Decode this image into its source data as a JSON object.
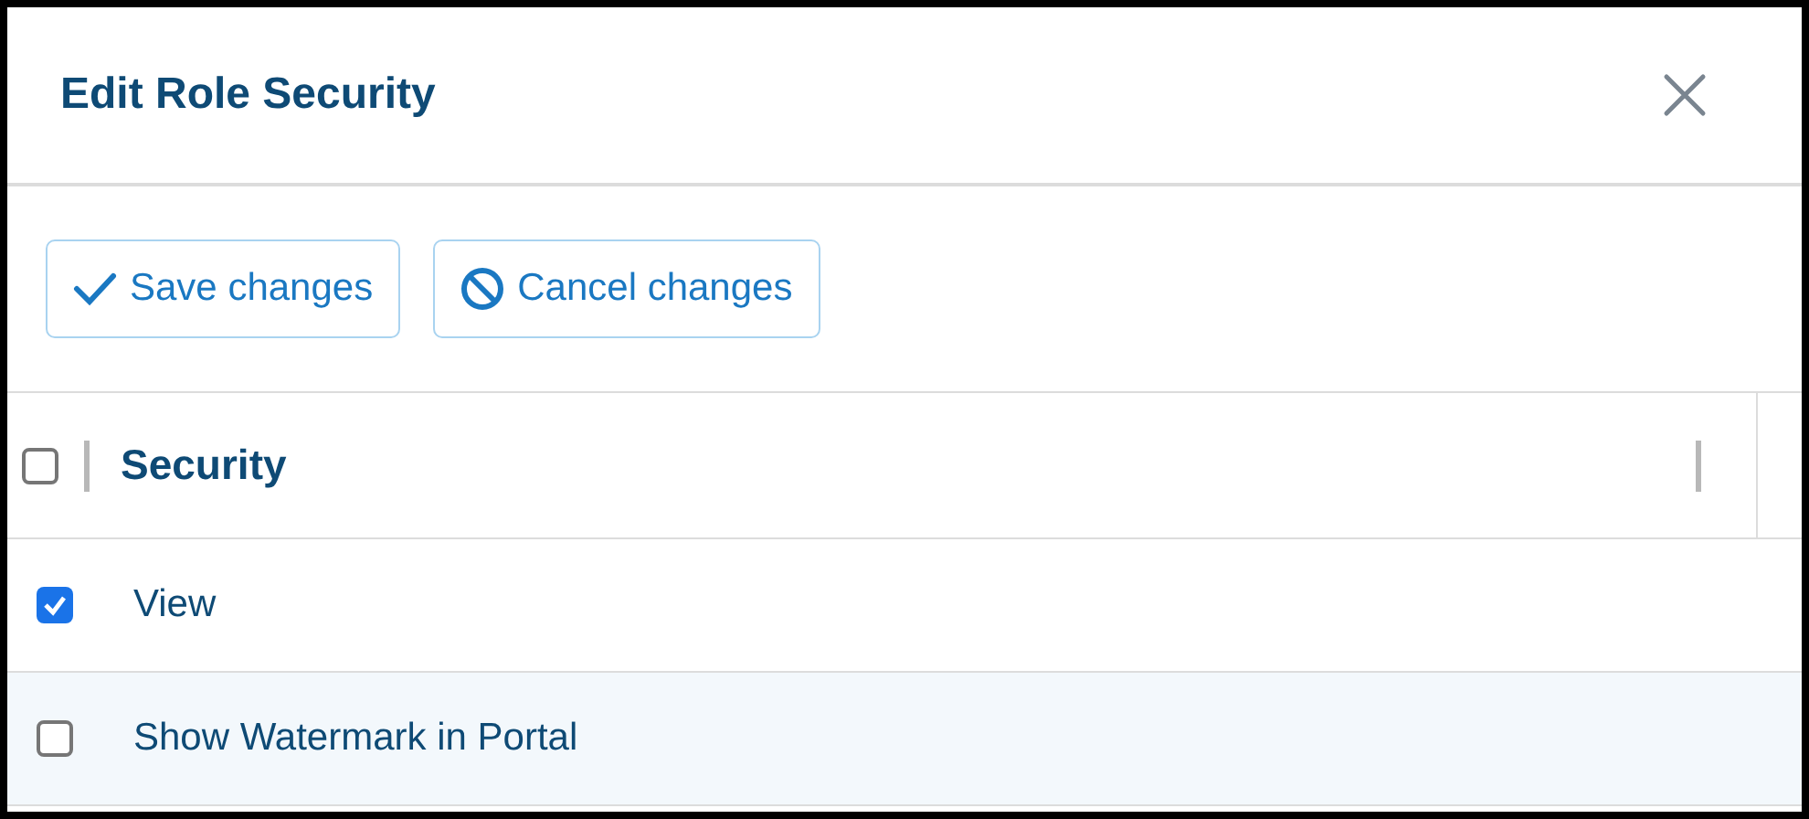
{
  "dialog": {
    "title": "Edit Role Security"
  },
  "toolbar": [
    {
      "kind": "save",
      "label": "Save changes"
    },
    {
      "kind": "cancel",
      "label": "Cancel changes"
    }
  ],
  "table": {
    "select_all": {
      "checked": false
    },
    "columns": [
      "Security"
    ],
    "rows": [
      {
        "label": "View",
        "checked": true,
        "highlighted": false
      },
      {
        "label": "Show Watermark in Portal",
        "checked": false,
        "highlighted": true
      }
    ]
  }
}
